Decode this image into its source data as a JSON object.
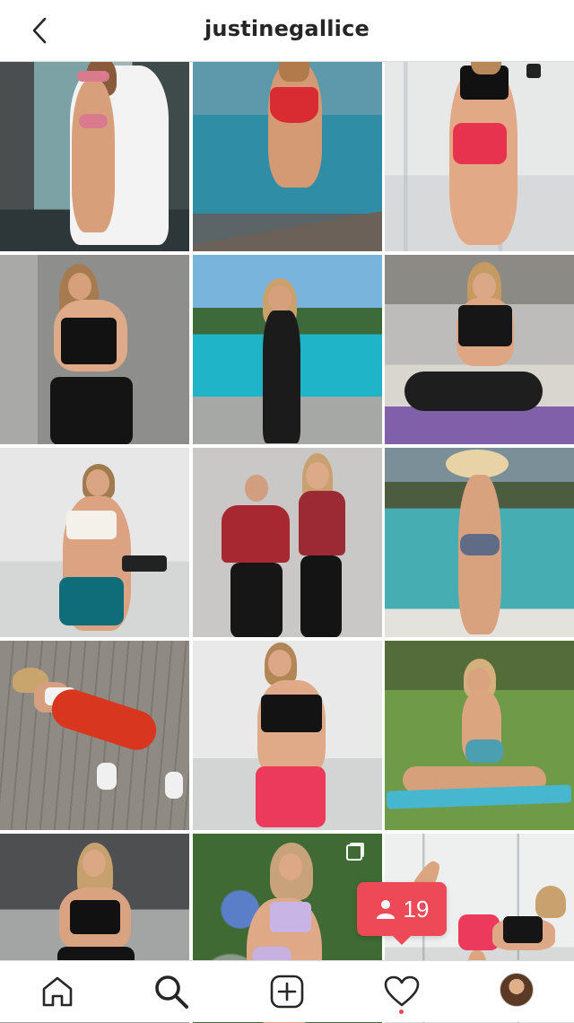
{
  "header": {
    "username": "justinegallice",
    "back_icon": "chevron-left-icon"
  },
  "posts": [
    {
      "label": "post-1",
      "scene": "poolside-robe"
    },
    {
      "label": "post-2",
      "scene": "infinity-pool-red-swimsuit"
    },
    {
      "label": "post-3",
      "scene": "gym-pink-shorts-dumbbell"
    },
    {
      "label": "post-4",
      "scene": "concrete-wall-sowl-top"
    },
    {
      "label": "post-5",
      "scene": "pool-black-dress"
    },
    {
      "label": "post-6",
      "scene": "yoga-sofa-purple-mat"
    },
    {
      "label": "post-7",
      "scene": "flex-dumbbell-teal-shorts"
    },
    {
      "label": "post-8",
      "scene": "duo-sowl-red-tops"
    },
    {
      "label": "post-9",
      "scene": "pool-straw-hat"
    },
    {
      "label": "post-10",
      "scene": "wood-deck-red-leggings"
    },
    {
      "label": "post-11",
      "scene": "gym-pink-shorts-black-top"
    },
    {
      "label": "post-12",
      "scene": "lawn-blue-mat-lunge"
    },
    {
      "label": "post-13",
      "scene": "studio-sowl-black-set"
    },
    {
      "label": "post-14",
      "scene": "garden-lilac-bikini"
    },
    {
      "label": "post-15",
      "scene": "studio-donkey-kick"
    }
  ],
  "notification": {
    "icon": "person-icon",
    "count": "19"
  },
  "tabbar": {
    "items": [
      {
        "name": "home-tab",
        "icon": "home-icon"
      },
      {
        "name": "search-tab",
        "icon": "search-icon"
      },
      {
        "name": "new-post-tab",
        "icon": "plus-square-icon"
      },
      {
        "name": "activity-tab",
        "icon": "heart-icon"
      },
      {
        "name": "profile-tab",
        "icon": "avatar"
      }
    ]
  },
  "colors": {
    "notification_red": "#ed4956",
    "text_dark": "#262626",
    "divider": "#dbdbdb"
  }
}
